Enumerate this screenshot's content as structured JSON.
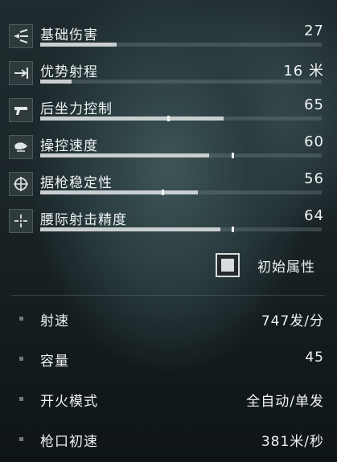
{
  "stats": [
    {
      "label": "基础伤害",
      "value": "27",
      "icon": "damage-icon",
      "fill": 0.27
    },
    {
      "label": "优势射程",
      "value": "16 米",
      "icon": "range-icon",
      "fill": 0.11
    },
    {
      "label": "后坐力控制",
      "value": "65",
      "icon": "recoil-icon",
      "fill": 0.65,
      "marker": 0.45
    },
    {
      "label": "操控速度",
      "value": "60",
      "icon": "handling-icon",
      "fill": 0.6,
      "marker": 0.68
    },
    {
      "label": "据枪稳定性",
      "value": "56",
      "icon": "stability-icon",
      "fill": 0.56,
      "marker": 0.43
    },
    {
      "label": "腰际射击精度",
      "value": "64",
      "icon": "hipfire-icon",
      "fill": 0.64,
      "marker": 0.68
    }
  ],
  "legend": {
    "label": "初始属性"
  },
  "details": [
    {
      "label": "射速",
      "value": "747发/分"
    },
    {
      "label": "容量",
      "value": "45"
    },
    {
      "label": "开火模式",
      "value": "全自动/单发"
    },
    {
      "label": "枪口初速",
      "value": "381米/秒"
    }
  ]
}
